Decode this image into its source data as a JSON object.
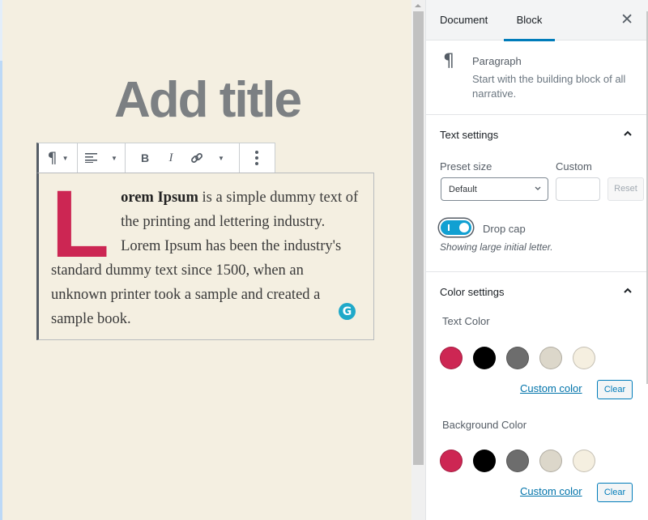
{
  "editor": {
    "title_placeholder": "Add title",
    "toolbar": {
      "block_type_icon": "paragraph-icon",
      "align_icon": "align-left-icon",
      "bold_label": "B",
      "italic_label": "I",
      "link_icon": "link-icon",
      "more_icon": "more-vertical-icon"
    },
    "paragraph": {
      "drop_cap_letter": "L",
      "bold_lead": "orem Ipsum",
      "text": " is a simple dummy text of the printing and lettering industry. Lorem Ipsum has been the industry's standard dummy text since 1500, when an unknown printer took a sample and created a sample book.",
      "drop_cap_color": "#cc2653"
    },
    "grammarly_label": "G"
  },
  "sidebar": {
    "tabs": [
      {
        "label": "Document",
        "active": false
      },
      {
        "label": "Block",
        "active": true
      }
    ],
    "close_icon": "close-icon",
    "block_card": {
      "icon": "¶",
      "title": "Paragraph",
      "description": "Start with the building block of all narrative."
    },
    "text_settings": {
      "title": "Text settings",
      "preset_size_label": "Preset size",
      "preset_size_value": "Default",
      "custom_label": "Custom",
      "custom_value": "",
      "reset_label": "Reset",
      "drop_cap_label": "Drop cap",
      "drop_cap_enabled": true,
      "drop_cap_help": "Showing large initial letter."
    },
    "color_settings": {
      "title": "Color settings",
      "text_color_label": "Text Color",
      "background_color_label": "Background Color",
      "palette": [
        "#cd2653",
        "#000000",
        "#6d6d6d",
        "#dcd7ca",
        "#f5efe0"
      ],
      "custom_color_label": "Custom color",
      "clear_label": "Clear"
    }
  },
  "colors": {
    "accent": "#007cba",
    "canvas_background": "#f4efe1",
    "title_placeholder": "#7c8083"
  }
}
